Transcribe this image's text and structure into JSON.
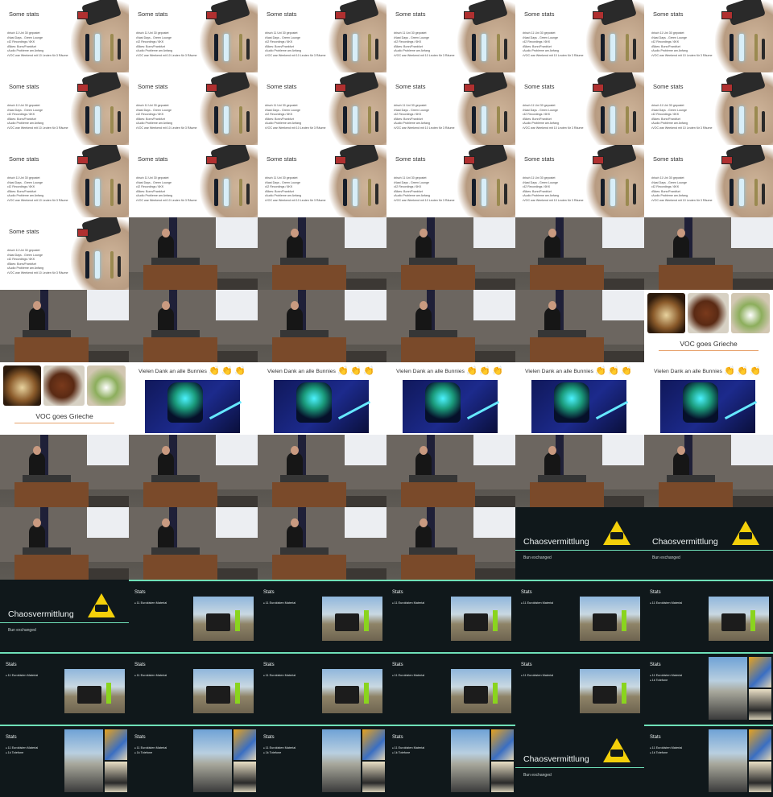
{
  "stats_slide": {
    "title": "Some stats",
    "bullets": [
      "bisch 11 Uni 30 gepostet",
      "Nast Days - Green Lounge",
      "42 Recordings / 6KK",
      "Bikes: Bonn/Frankfurt",
      "Audio Probleme am Anfang",
      "VOC war Weekend mit 10 Leuten für 3 Räume"
    ]
  },
  "food_slide": {
    "title": "VOC goes Grieche"
  },
  "thanks_slide": {
    "title": "Vielen Dank an alle Bunnies",
    "clap": "👏"
  },
  "chaos_slide": {
    "title": "Chaosvermittlung",
    "subtitle": "Bun exchanged"
  },
  "dark_stats_slide": {
    "title": "Stats",
    "bullets_a": [
      "11 Eurokisten Material"
    ],
    "bullets_b": [
      "11 Eurokisten Material",
      "1k Totefone"
    ]
  },
  "grid": {
    "cols": 6,
    "tiles": [
      "stats",
      "stats",
      "stats",
      "stats",
      "stats",
      "stats",
      "stats",
      "stats",
      "stats",
      "stats",
      "stats",
      "stats",
      "stats",
      "stats",
      "stats",
      "stats",
      "stats",
      "stats",
      "stats",
      "hall",
      "hall",
      "hall",
      "hall",
      "hall",
      "hall",
      "hall",
      "hall",
      "hall",
      "hall",
      "food",
      "food",
      "thanks",
      "thanks",
      "thanks",
      "thanks",
      "thanks",
      "hall",
      "hall",
      "hall",
      "hall",
      "hall",
      "hall",
      "hall",
      "hall",
      "hall",
      "hall",
      "chaos",
      "chaos",
      "chaos",
      "dstats_a",
      "dstats_a",
      "dstats_a",
      "dstats_a",
      "dstats_a",
      "dstats_a",
      "dstats_a",
      "dstats_a",
      "dstats_a",
      "dstats_a",
      "dstats_b",
      "dstats_b",
      "dstats_b",
      "dstats_b",
      "dstats_b",
      "chaos",
      "dstats_b"
    ]
  }
}
